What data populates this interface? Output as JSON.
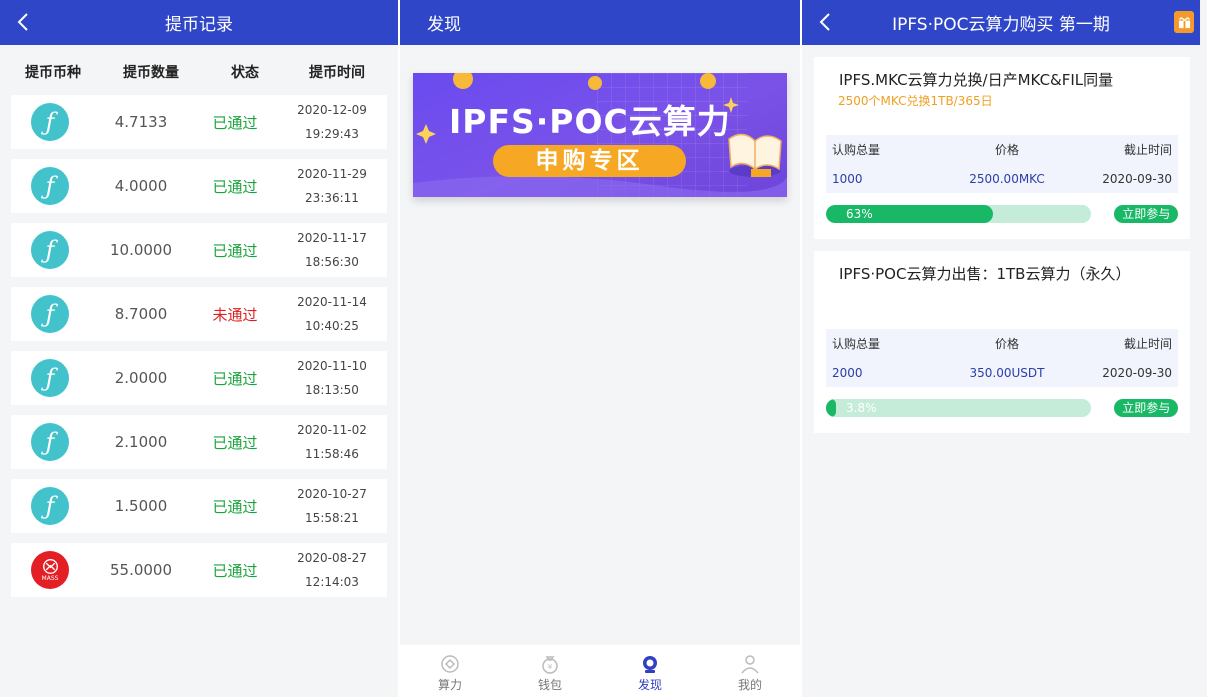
{
  "withdraw": {
    "title": "提币记录",
    "headers": [
      "提币币种",
      "提币数量",
      "状态",
      "提币时间"
    ],
    "rows": [
      {
        "coin": "fil",
        "amount": "4.7133",
        "status": "已通过",
        "date": "2020-12-09",
        "time": "19:29:43"
      },
      {
        "coin": "fil",
        "amount": "4.0000",
        "status": "已通过",
        "date": "2020-11-29",
        "time": "23:36:11"
      },
      {
        "coin": "fil",
        "amount": "10.0000",
        "status": "已通过",
        "date": "2020-11-17",
        "time": "18:56:30"
      },
      {
        "coin": "fil",
        "amount": "8.7000",
        "status": "未通过",
        "date": "2020-11-14",
        "time": "10:40:25"
      },
      {
        "coin": "fil",
        "amount": "2.0000",
        "status": "已通过",
        "date": "2020-11-10",
        "time": "18:13:50"
      },
      {
        "coin": "fil",
        "amount": "2.1000",
        "status": "已通过",
        "date": "2020-11-02",
        "time": "11:58:46"
      },
      {
        "coin": "fil",
        "amount": "1.5000",
        "status": "已通过",
        "date": "2020-10-27",
        "time": "15:58:21"
      },
      {
        "coin": "mass",
        "amount": "55.0000",
        "status": "已通过",
        "date": "2020-08-27",
        "time": "12:14:03"
      }
    ],
    "mass_label": "MASS"
  },
  "discover": {
    "title": "发现",
    "banner_title": "IPFS·POC云算力",
    "banner_button": "申购专区",
    "tabs": [
      {
        "label": "算力",
        "icon": "compute-icon"
      },
      {
        "label": "钱包",
        "icon": "wallet-icon"
      },
      {
        "label": "发现",
        "icon": "discover-icon"
      },
      {
        "label": "我的",
        "icon": "profile-icon"
      }
    ]
  },
  "purchase": {
    "title": "IPFS·POC云算力购买 第一期",
    "headers": {
      "total": "认购总量",
      "price": "价格",
      "deadline": "截止时间"
    },
    "join_label": "立即参与",
    "products": [
      {
        "name": "IPFS.MKC云算力兑换/日产MKC&FIL同量",
        "subtitle": "2500个MKC兑换1TB/365日",
        "total": "1000",
        "price": "2500.00MKC",
        "deadline": "2020-09-30",
        "progress": 63,
        "progress_label": "63%"
      },
      {
        "name": "IPFS·POC云算力出售：1TB云算力（永久）",
        "subtitle": "",
        "total": "2000",
        "price": "350.00USDT",
        "deadline": "2020-09-30",
        "progress": 3.8,
        "progress_label": "3.8%"
      }
    ]
  },
  "colors": {
    "header": "#2f46c8",
    "passed": "#1aa33c",
    "rejected": "#e02020",
    "progress": "#19b866",
    "subtitle": "#f0a020"
  }
}
